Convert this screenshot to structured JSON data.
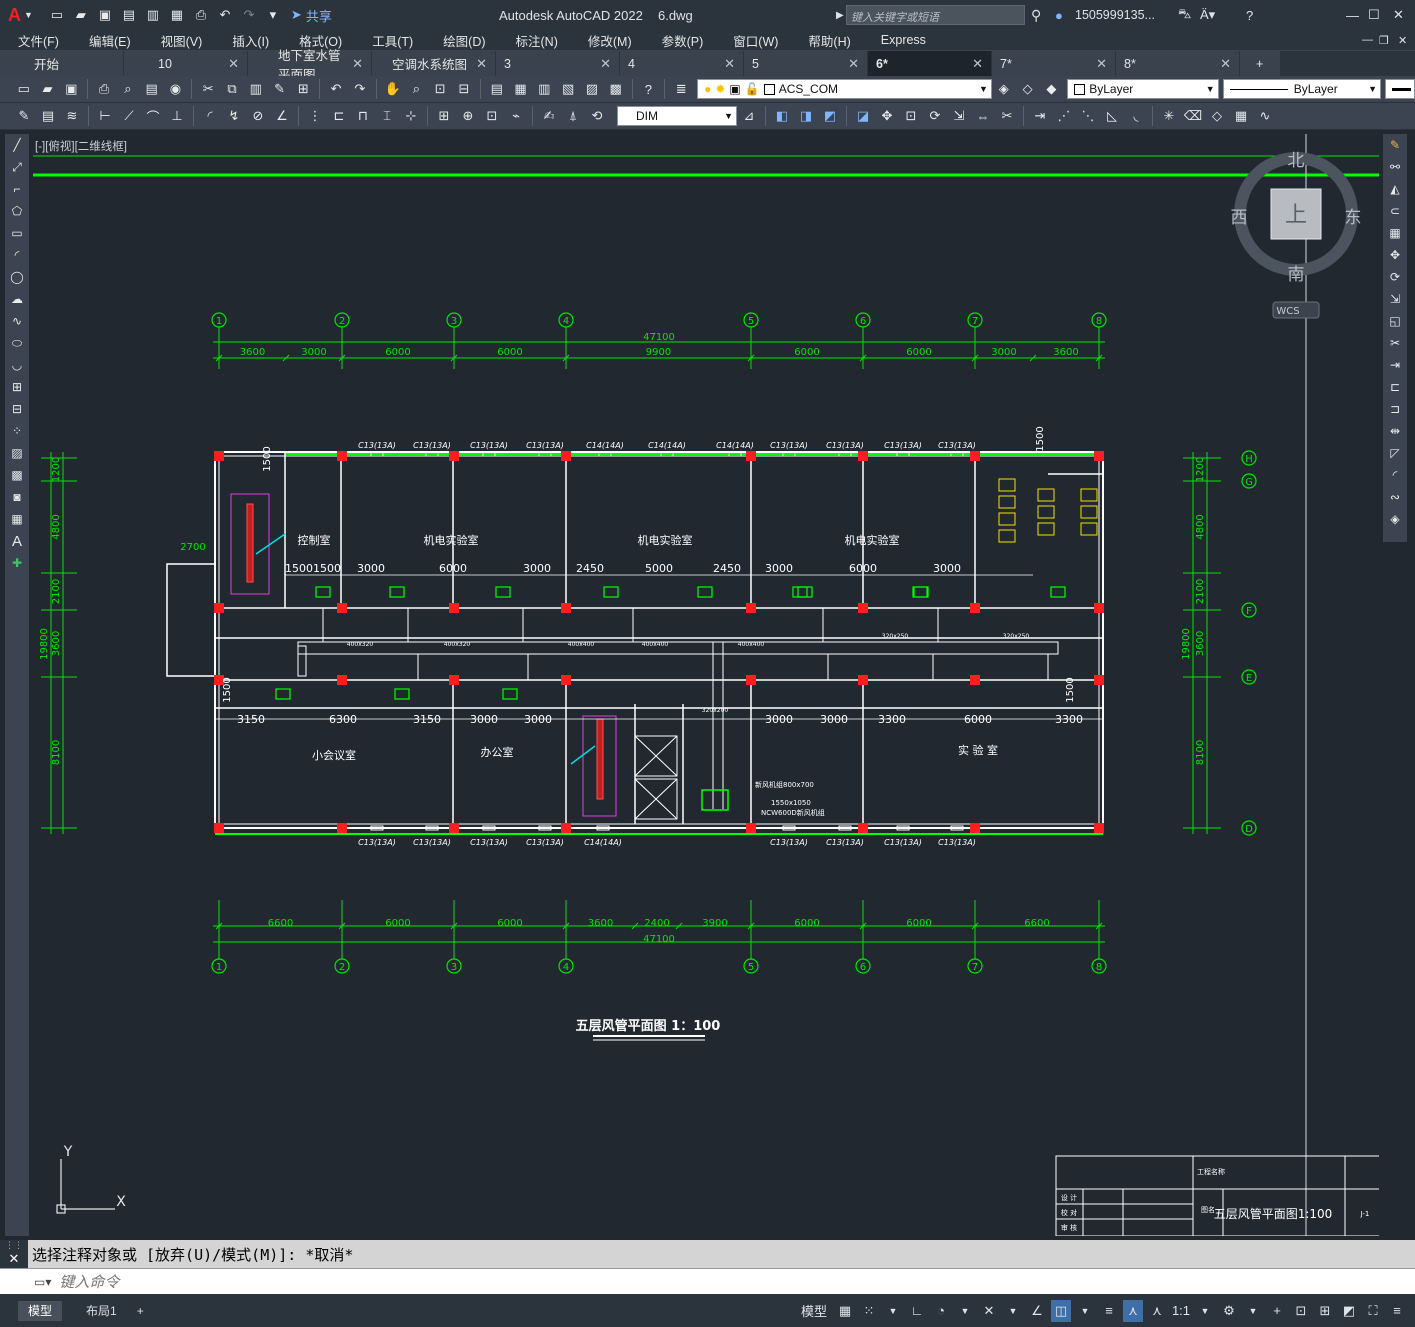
{
  "titlebar": {
    "app_logo": "A",
    "share_label": "共享",
    "app_title": "Autodesk AutoCAD 2022",
    "doc_name": "6.dwg",
    "search_placeholder": "键入关键字或短语",
    "user": "1505999135..."
  },
  "menu": [
    "文件(F)",
    "编辑(E)",
    "视图(V)",
    "插入(I)",
    "格式(O)",
    "工具(T)",
    "绘图(D)",
    "标注(N)",
    "修改(M)",
    "参数(P)",
    "窗口(W)",
    "帮助(H)",
    "Express"
  ],
  "file_tabs": [
    {
      "label": "开始",
      "active": false
    },
    {
      "label": "10",
      "active": false
    },
    {
      "label": "地下室水管平面图",
      "active": false
    },
    {
      "label": "空调水系统图",
      "active": false
    },
    {
      "label": "3",
      "active": false
    },
    {
      "label": "4",
      "active": false
    },
    {
      "label": "5",
      "active": false
    },
    {
      "label": "6*",
      "active": true
    },
    {
      "label": "7*",
      "active": false
    },
    {
      "label": "8*",
      "active": false
    }
  ],
  "toolbar": {
    "layer_name": "ACS_COM",
    "color_combo": "ByLayer",
    "linetype_combo": "ByLayer",
    "dim_style": "DIM"
  },
  "viewport": {
    "label": "[-][俯视][二维线框]",
    "wcs": "WCS",
    "viewcube_face": "上",
    "north": "北",
    "south": "南",
    "east": "东",
    "west": "西",
    "ucs_x": "X",
    "ucs_y": "Y"
  },
  "drawing": {
    "title": "五层风管平面图 1：100",
    "grid_top": [
      "1",
      "2",
      "3",
      "4",
      "5",
      "6",
      "7",
      "8"
    ],
    "grid_side": [
      "H",
      "G",
      "F",
      "E",
      "D"
    ],
    "dim_top_total": "47100",
    "dim_top": [
      "3600",
      "3000",
      "6000",
      "6000",
      "9900",
      "6000",
      "6000",
      "3000",
      "3600"
    ],
    "dim_bottom": [
      "6600",
      "6000",
      "6000",
      "3600",
      "2400",
      "3900",
      "6000",
      "6000",
      "6600"
    ],
    "dim_bottom_total": "47100",
    "dim_left": [
      "1200",
      "4800",
      "2100",
      "3600",
      "8100"
    ],
    "dim_left_total": "19800",
    "dim_right": [
      "1200",
      "4800",
      "2100",
      "3600",
      "8100"
    ],
    "dim_right_total": "19800",
    "rooms": [
      "控制室",
      "机电实验室",
      "机电实验室",
      "机电实验室",
      "小会议室",
      "办公室",
      "实 验 室"
    ],
    "row1_dims": [
      "1500",
      "1500",
      "3000",
      "6000",
      "3000",
      "2450",
      "5000",
      "2450",
      "3000",
      "6000",
      "3000"
    ],
    "row2_dims": [
      "3150",
      "6300",
      "3150",
      "3000",
      "3000",
      "3000",
      "3000",
      "3300",
      "6000",
      "3300"
    ],
    "window_labels_top": [
      "C13(13A)",
      "C13(13A)",
      "C13(13A)",
      "C13(13A)",
      "C14(14A)",
      "C14(14A)",
      "C14(14A)",
      "C13(13A)",
      "C13(13A)",
      "C13(13A)",
      "C13(13A)"
    ],
    "window_labels_bottom": [
      "C13(13A)",
      "C13(13A)",
      "C13(13A)",
      "C13(13A)",
      "C14(14A)",
      "C13(13A)",
      "C13(13A)",
      "C13(13A)",
      "C13(13A)"
    ],
    "duct_sizes": [
      "400x320",
      "400x320",
      "400x400",
      "400x400",
      "400x400",
      "320x250",
      "320x250",
      "320x200"
    ],
    "ahu_notes": [
      "新风机组800x700",
      "1550x1050",
      "NCW600D新风机组"
    ],
    "small_dims": [
      "2700",
      "1500",
      "1500",
      "1500",
      "1500"
    ],
    "title_block": {
      "drawing_name": "五层风管平面图1:100",
      "rows": [
        "设 计",
        "校 对",
        "审 核"
      ],
      "project": "工程名称",
      "content_label": "图名",
      "sheet": "J-1"
    }
  },
  "command": {
    "history": "选择注释对象或 [放弃(U)/模式(M)]: *取消*",
    "placeholder": "键入命令"
  },
  "status": {
    "layout_tabs": [
      "模型",
      "布局1"
    ],
    "model_label": "模型",
    "scale": "1:1"
  },
  "colors": {
    "canvas": "#212830",
    "dim_green": "#00e600",
    "wall_white": "#ffffff",
    "column_red": "#ff1e1e",
    "duct_green": "#00ff00"
  }
}
